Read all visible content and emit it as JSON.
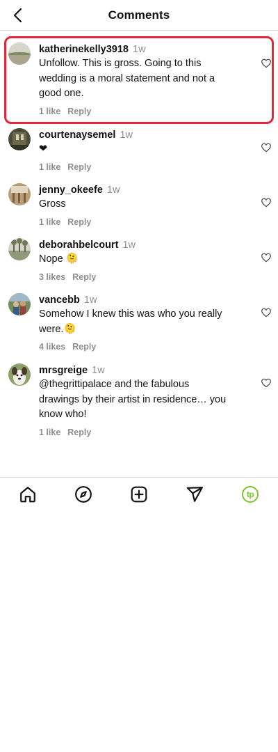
{
  "header": {
    "title": "Comments",
    "back_icon": "chevron-left-icon"
  },
  "comments": [
    {
      "username": "katherinekelly3918",
      "time": "1w",
      "text": "Unfollow. This is gross. Going to this wedding is a moral statement and not a good one.",
      "likes": "1 like",
      "reply": "Reply",
      "highlighted": true
    },
    {
      "username": "courtenaysemel",
      "time": "1w",
      "text": "❤",
      "likes": "1 like",
      "reply": "Reply"
    },
    {
      "username": "jenny_okeefe",
      "time": "1w",
      "text": "Gross",
      "likes": "1 like",
      "reply": "Reply"
    },
    {
      "username": "deborahbelcourt",
      "time": "1w",
      "text": "Nope 🫠",
      "likes": "3 likes",
      "reply": "Reply"
    },
    {
      "username": "vancebb",
      "time": "1w",
      "text": "Somehow I knew this was who you really were.🫠",
      "likes": "4 likes",
      "reply": "Reply"
    },
    {
      "username": "mrsgreige",
      "time": "1w",
      "text": "@thegrittipalace and the fabulous drawings by their artist in residence… you know who!",
      "likes": "1 like",
      "reply": "Reply"
    }
  ],
  "bottom_nav": [
    {
      "name": "home-icon"
    },
    {
      "name": "compass-icon"
    },
    {
      "name": "add-post-icon"
    },
    {
      "name": "send-icon"
    },
    {
      "name": "profile-logo",
      "label": "tp"
    }
  ],
  "colors": {
    "highlight": "#e3263a",
    "muted": "#8e8e8e",
    "divider": "#dbdbdb",
    "logo": "#7cc62b"
  }
}
